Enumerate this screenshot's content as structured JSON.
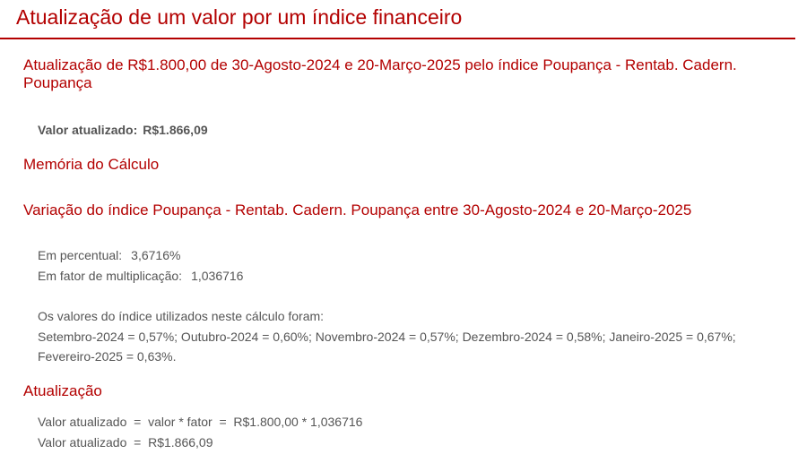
{
  "title": "Atualização de um valor por um índice financeiro",
  "subtitle": "Atualização de R$1.800,00 de 30-Agosto-2024 e 20-Março-2025 pelo índice Poupança - Rentab. Cadern. Poupança",
  "result": {
    "label": "Valor atualizado:",
    "value": "R$1.866,09"
  },
  "memoria": {
    "heading": "Memória do Cálculo"
  },
  "variacao": {
    "heading": "Variação do índice Poupança - Rentab. Cadern. Poupança entre 30-Agosto-2024 e 20-Março-2025",
    "percent_label": "Em percentual:",
    "percent_value": "3,6716%",
    "factor_label": "Em fator de multiplicação:",
    "factor_value": "1,036716",
    "indices_intro": "Os valores do índice utilizados neste cálculo foram:",
    "indices_list": "Setembro-2024 = 0,57%; Outubro-2024 = 0,60%; Novembro-2024 = 0,57%; Dezembro-2024 = 0,58%; Janeiro-2025 = 0,67%; Fevereiro-2025 = 0,63%."
  },
  "atualizacao": {
    "heading": "Atualização",
    "formula_line": "Valor atualizado  =  valor * fator  =  R$1.800,00 * 1,036716",
    "result_line": "Valor atualizado  =  R$1.866,09"
  },
  "colors": {
    "accent": "#b30000",
    "text": "#555555"
  }
}
